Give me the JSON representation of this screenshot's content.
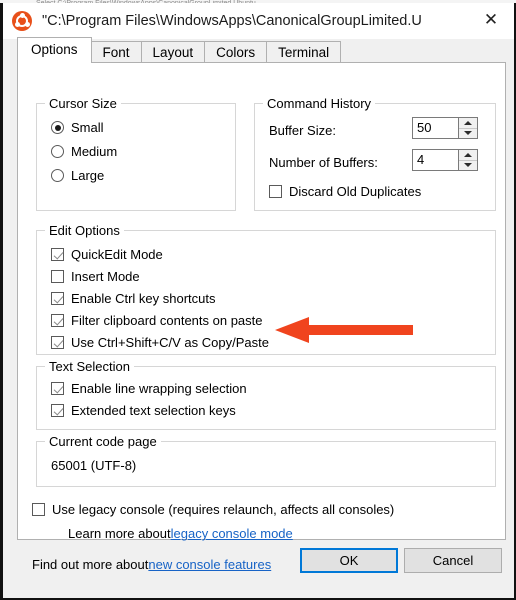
{
  "background_window": {
    "strip_text": "Select C:\\Program Files\\WindowsApps\\CanonicalGroupLimited.Ubuntu"
  },
  "titlebar": {
    "icon": "ubuntu-logo-icon",
    "title": "\"C:\\Program Files\\WindowsApps\\CanonicalGroupLimited.Ubuntu…",
    "close_label": "✕"
  },
  "tabs": [
    {
      "label": "Options",
      "active": true
    },
    {
      "label": "Font",
      "active": false
    },
    {
      "label": "Layout",
      "active": false
    },
    {
      "label": "Colors",
      "active": false
    },
    {
      "label": "Terminal",
      "active": false
    }
  ],
  "cursor_size": {
    "title": "Cursor Size",
    "options": [
      {
        "label": "Small",
        "checked": true
      },
      {
        "label": "Medium",
        "checked": false
      },
      {
        "label": "Large",
        "checked": false
      }
    ]
  },
  "command_history": {
    "title": "Command History",
    "buffer_size_label": "Buffer Size:",
    "buffer_size_value": "50",
    "number_of_buffers_label": "Number of Buffers:",
    "number_of_buffers_value": "4",
    "discard_label": "Discard Old Duplicates",
    "discard_checked": false
  },
  "edit_options": {
    "title": "Edit Options",
    "items": [
      {
        "label": "QuickEdit Mode",
        "checked": true
      },
      {
        "label": "Insert Mode",
        "checked": false
      },
      {
        "label": "Enable Ctrl key shortcuts",
        "checked": true
      },
      {
        "label": "Filter clipboard contents on paste",
        "checked": true
      },
      {
        "label": "Use Ctrl+Shift+C/V as Copy/Paste",
        "checked": true
      }
    ]
  },
  "text_selection": {
    "title": "Text Selection",
    "items": [
      {
        "label": "Enable line wrapping selection",
        "checked": true
      },
      {
        "label": "Extended text selection keys",
        "checked": true
      }
    ]
  },
  "code_page": {
    "title": "Current code page",
    "value": "65001 (UTF-8)"
  },
  "legacy": {
    "checkbox_label": "Use legacy console (requires relaunch, affects all consoles)",
    "checkbox_checked": false,
    "learn_more_prefix": "Learn more about ",
    "learn_more_link": "legacy console mode",
    "find_out_prefix": "Find out more about ",
    "find_out_link": "new console features"
  },
  "footer": {
    "ok_label": "OK",
    "cancel_label": "Cancel"
  },
  "annotation": {
    "name": "red-arrow-pointing-to-copy-paste-option",
    "color": "#f0441e",
    "direction": "left"
  }
}
